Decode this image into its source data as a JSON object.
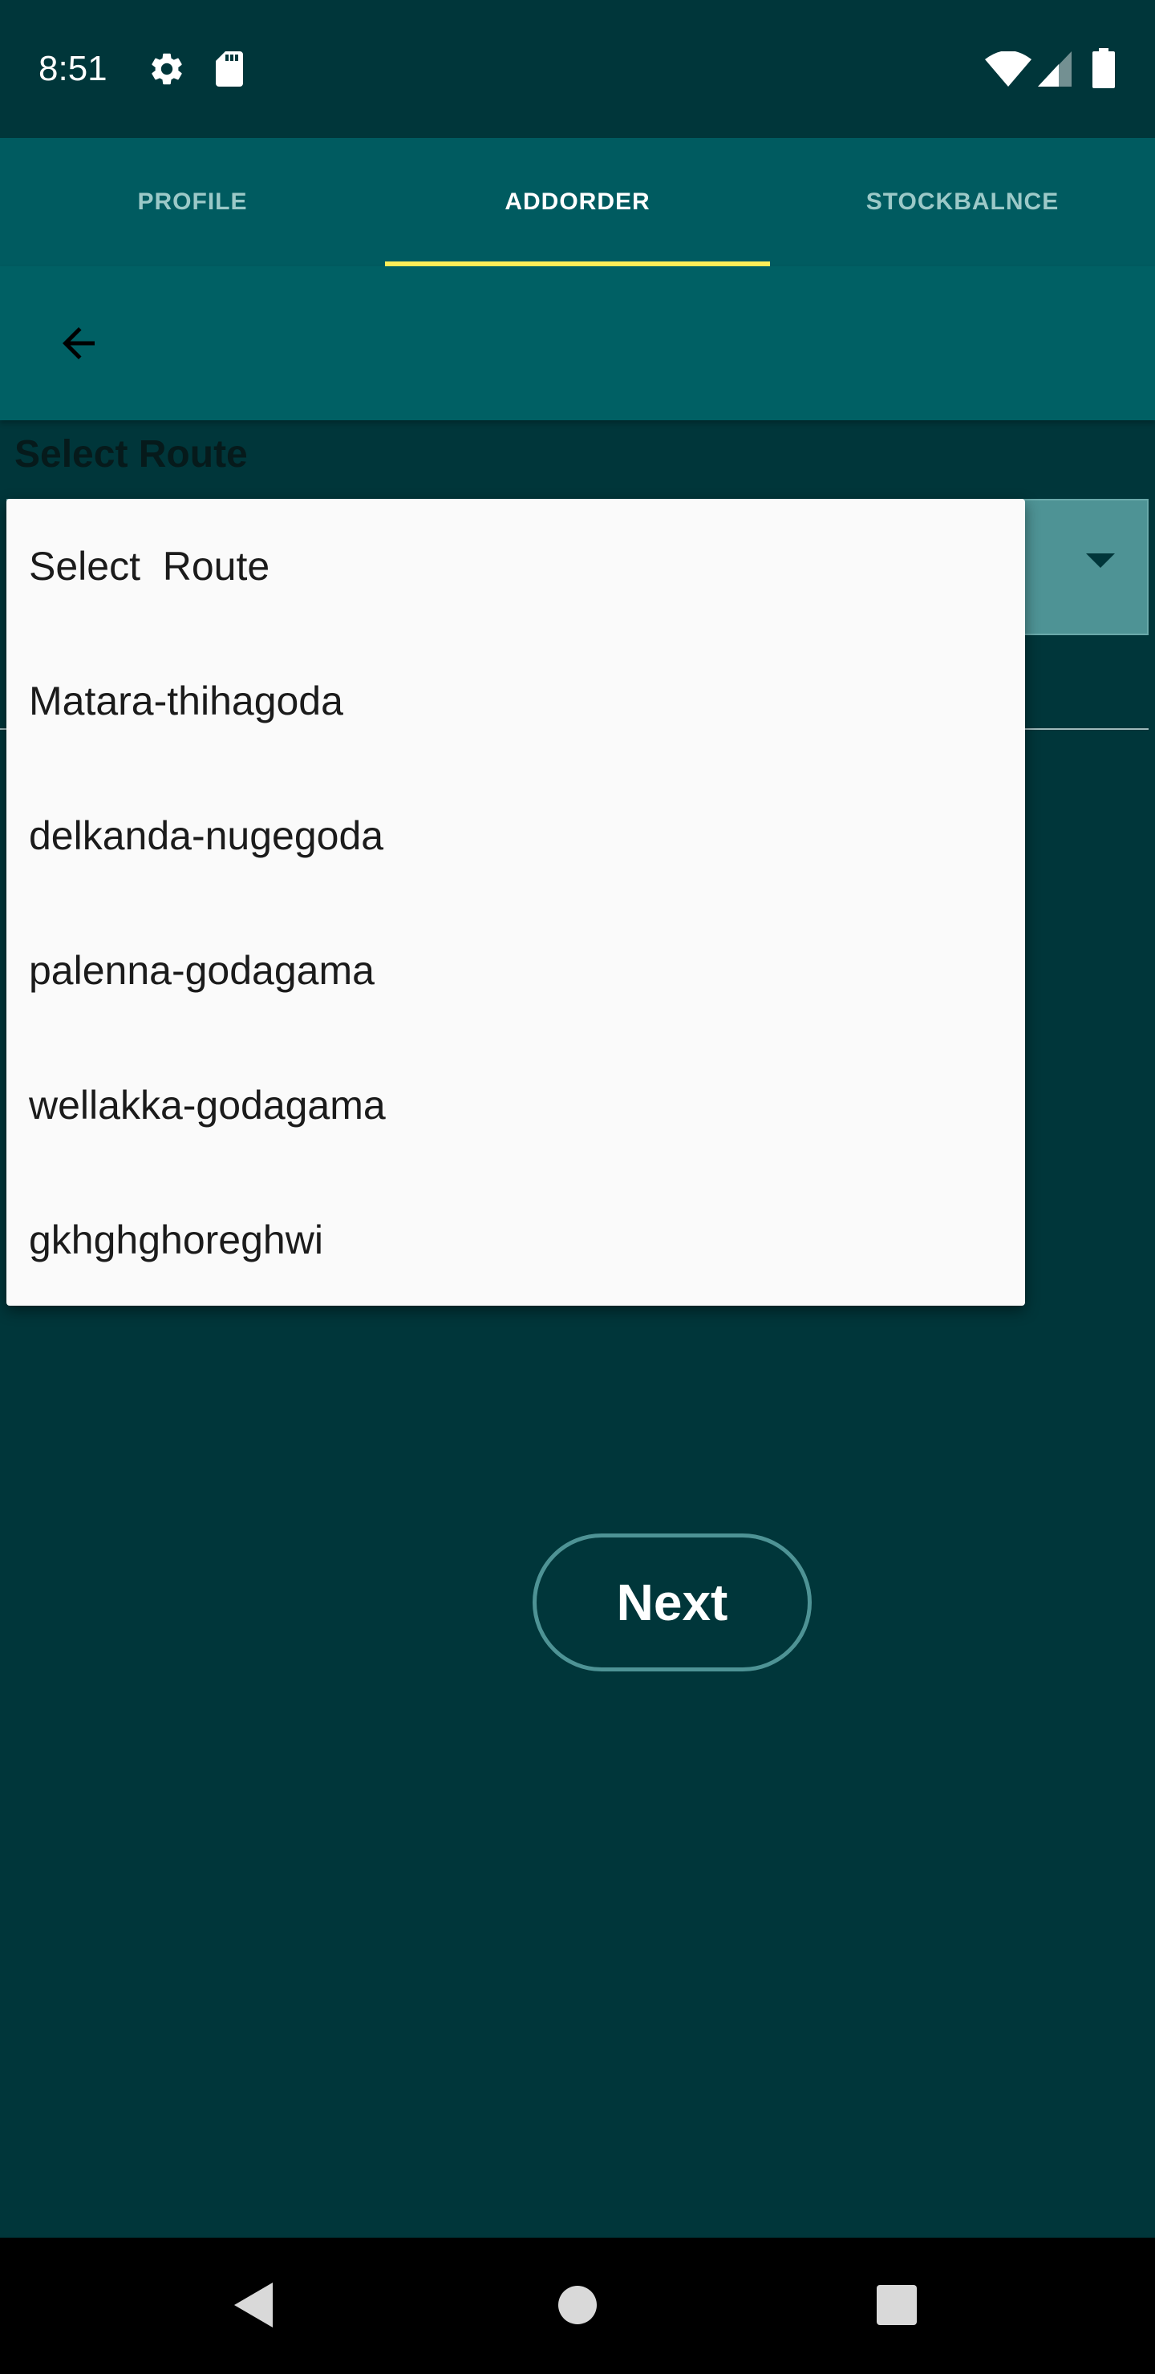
{
  "status_bar": {
    "time": "8:51",
    "left_icons": [
      "gear-icon",
      "sd-card-icon"
    ],
    "right_icons": [
      "wifi-icon",
      "cell-signal-icon",
      "battery-icon"
    ]
  },
  "tabs": [
    {
      "label": "PROFILE",
      "active": false
    },
    {
      "label": "ADDORDER",
      "active": true
    },
    {
      "label": "STOCKBALNCE",
      "active": false
    }
  ],
  "toolbar": {
    "back_icon": "arrow-back-icon"
  },
  "form": {
    "route_label": "Select Route",
    "dropdown_arrow_icon": "triangle-down-icon"
  },
  "dropdown": {
    "options": [
      "Select  Route",
      "Matara-thihagoda",
      "delkanda-nugegoda",
      "palenna-godagama",
      "wellakka-godagama",
      "gkhghghoreghwi"
    ]
  },
  "actions": {
    "next_label": "Next"
  },
  "navigation": {
    "icons": [
      "back-triangle-icon",
      "home-circle-icon",
      "recents-square-icon"
    ]
  },
  "colors": {
    "background": "#00363a",
    "tab_bar": "#005b60",
    "toolbar": "#006064",
    "tab_indicator": "#ffee58",
    "accent_outline": "#4e9395"
  }
}
